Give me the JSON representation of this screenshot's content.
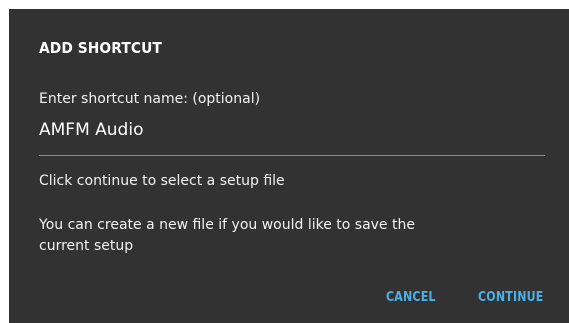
{
  "dialog": {
    "title": "ADD SHORTCUT",
    "name_label": "Enter shortcut name: (optional)",
    "name_value": "AMFM Audio",
    "info_continue": "Click continue to select a setup file",
    "info_create": "You can create a new file if you would like to save the current setup",
    "cancel_label": "CANCEL",
    "continue_label": "CONTINUE"
  },
  "colors": {
    "dialog_background": "#323232",
    "accent": "#4cb0e6",
    "underline": "#8a8a8a"
  }
}
